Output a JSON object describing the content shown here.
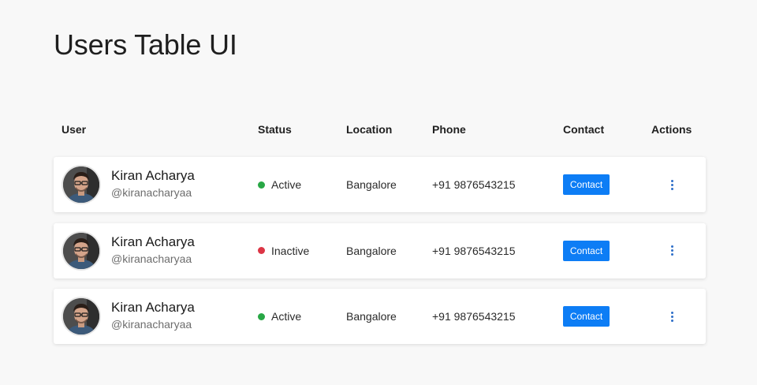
{
  "page": {
    "title": "Users Table UI"
  },
  "table": {
    "headers": {
      "user": "User",
      "status": "Status",
      "location": "Location",
      "phone": "Phone",
      "contact": "Contact",
      "actions": "Actions"
    },
    "rows": [
      {
        "name": "Kiran Acharya",
        "handle": "@kiranacharyaa",
        "status": "Active",
        "status_color": "#28a745",
        "location": "Bangalore",
        "phone": "+91 9876543215",
        "contact_label": "Contact"
      },
      {
        "name": "Kiran Acharya",
        "handle": "@kiranacharyaa",
        "status": "Inactive",
        "status_color": "#dc3545",
        "location": "Bangalore",
        "phone": "+91 9876543215",
        "contact_label": "Contact"
      },
      {
        "name": "Kiran Acharya",
        "handle": "@kiranacharyaa",
        "status": "Active",
        "status_color": "#28a745",
        "location": "Bangalore",
        "phone": "+91 9876543215",
        "contact_label": "Contact"
      }
    ]
  },
  "colors": {
    "background": "#f8f8f8",
    "accent": "#0d7df5",
    "active": "#28a745",
    "inactive": "#dc3545"
  },
  "icons": {
    "actions": "kebab-menu-icon",
    "status": "status-dot-icon"
  }
}
